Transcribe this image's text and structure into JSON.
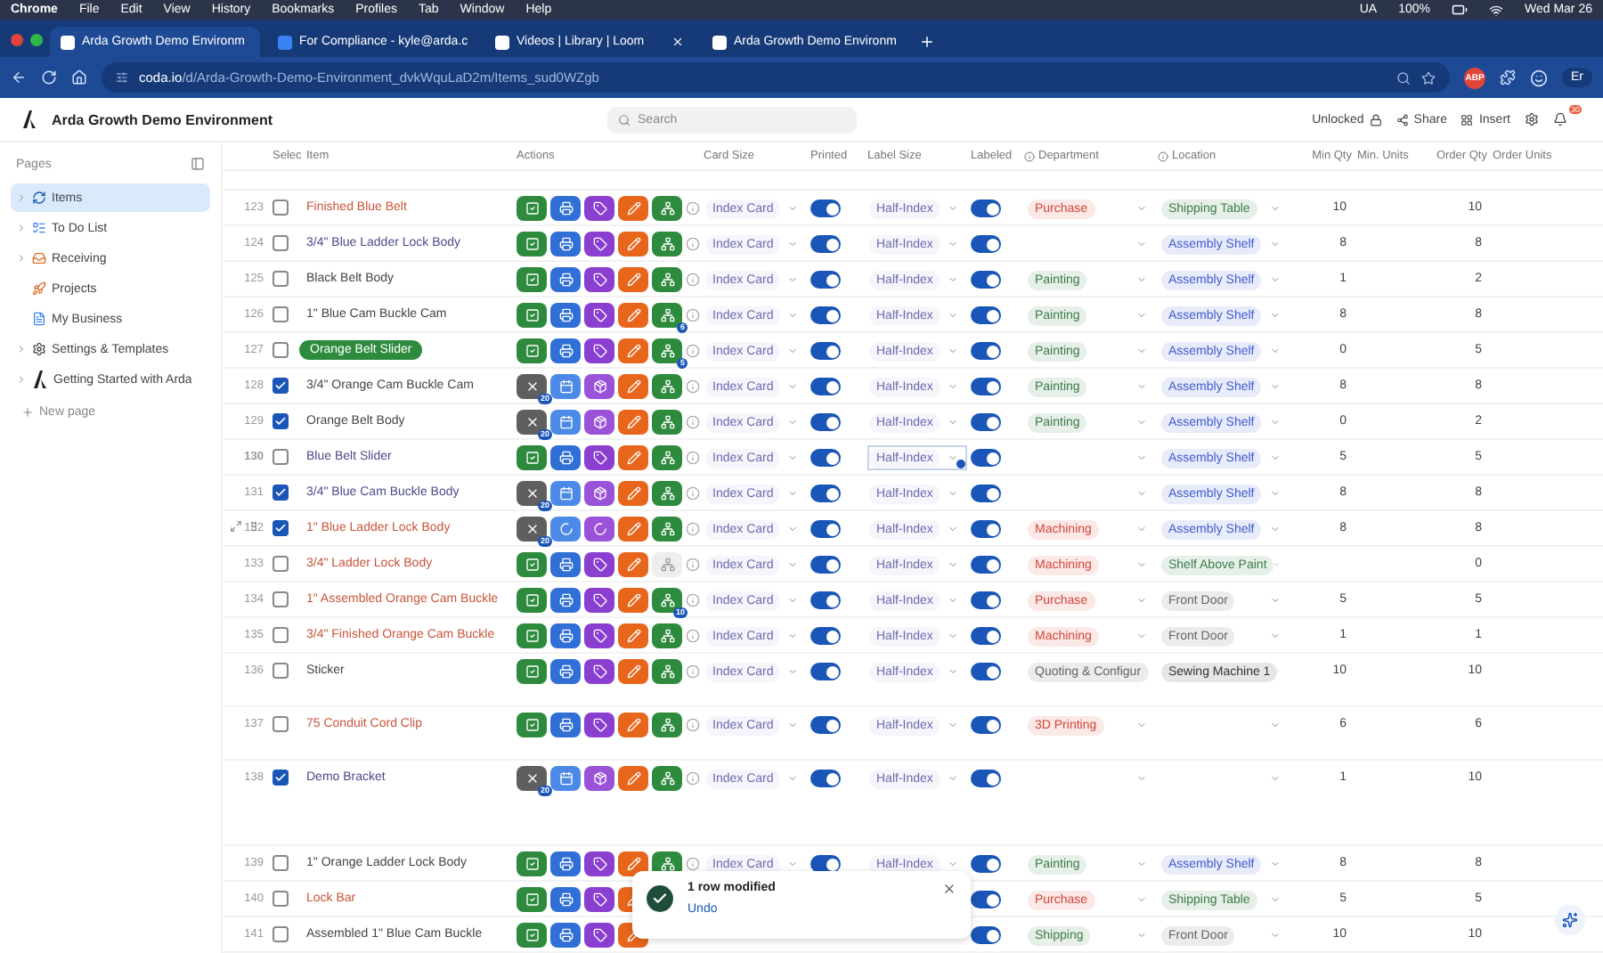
{
  "menu_bar": {
    "app": "Chrome",
    "menus": [
      "File",
      "Edit",
      "View",
      "History",
      "Bookmarks",
      "Profiles",
      "Tab",
      "Window",
      "Help"
    ],
    "keyboard": "UA",
    "battery": "100%",
    "clock": "Wed Mar 26"
  },
  "browser": {
    "tabs": [
      {
        "title": "Arda Growth Demo Environm",
        "selected": true
      },
      {
        "title": "For Compliance - kyle@arda.c",
        "selected": false
      },
      {
        "title": "Videos | Library | Loom",
        "selected": false
      },
      {
        "title": "Arda Growth Demo Environm",
        "selected": false
      }
    ],
    "url_host": "coda.io",
    "url_path": "/d/Arda-Growth-Demo-Environment_dvkWquLaD2m/Items_sud0WZgb",
    "extension_badge": "ABP",
    "profile": "Er"
  },
  "doc": {
    "title": "Arda Growth Demo Environment",
    "search_placeholder": "Search",
    "lock_status": "Unlocked",
    "share": "Share",
    "insert": "Insert",
    "notification_count": "30"
  },
  "sidebar": {
    "heading": "Pages",
    "items": [
      {
        "label": "Items",
        "selected": true,
        "expandable": true
      },
      {
        "label": "To Do List",
        "selected": false,
        "expandable": true
      },
      {
        "label": "Receiving",
        "selected": false,
        "expandable": true
      },
      {
        "label": "Projects",
        "selected": false,
        "expandable": false
      },
      {
        "label": "My Business",
        "selected": false,
        "expandable": false
      },
      {
        "label": "Settings & Templates",
        "selected": false,
        "expandable": true
      },
      {
        "label": "Getting Started with Arda",
        "selected": false,
        "expandable": true
      }
    ],
    "new_page": "New page"
  },
  "table": {
    "columns": [
      {
        "label": "Selec",
        "info": false
      },
      {
        "label": "Item",
        "info": false
      },
      {
        "label": "Actions",
        "info": false
      },
      {
        "label": "Card Size",
        "info": false
      },
      {
        "label": "Printed",
        "info": false
      },
      {
        "label": "Label Size",
        "info": false
      },
      {
        "label": "Labeled",
        "info": false
      },
      {
        "label": "Department",
        "info": true
      },
      {
        "label": "Location",
        "info": true
      },
      {
        "label": "Min Qty",
        "info": false
      },
      {
        "label": "Min. Units",
        "info": false
      },
      {
        "label": "Order Qty",
        "info": false
      },
      {
        "label": "Order Units",
        "info": false
      }
    ],
    "rows": [
      {
        "number": "123",
        "checked": false,
        "item": {
          "text": "Finished Blue Belt",
          "kind": "text",
          "color": "#c9553b"
        },
        "actions": {
          "kind": "ready",
          "share_disabled": false
        },
        "card_size": "Index Card",
        "printed": true,
        "label_size": "Half-Index",
        "label_focused": false,
        "labeled": true,
        "department": {
          "text": "Purchase",
          "color": "#d4473a"
        },
        "location": {
          "text": "Shipping Table",
          "color": "#3b7d48"
        },
        "min_qty": "10",
        "order_qty": "10",
        "hovered": false
      },
      {
        "number": "124",
        "checked": false,
        "item": {
          "text": "3/4\" Blue Ladder Lock Body",
          "kind": "text",
          "color": "#4b4a8c"
        },
        "actions": {
          "kind": "ready",
          "share_disabled": false
        },
        "card_size": "Index Card",
        "printed": true,
        "label_size": "Half-Index",
        "label_focused": false,
        "labeled": true,
        "location": {
          "text": "Assembly Shelf",
          "color": "#3f5bd0"
        },
        "min_qty": "8",
        "order_qty": "8",
        "hovered": false
      },
      {
        "number": "125",
        "checked": false,
        "item": {
          "text": "Black Belt Body",
          "kind": "text",
          "color": "#444444"
        },
        "actions": {
          "kind": "ready",
          "share_disabled": false
        },
        "card_size": "Index Card",
        "printed": true,
        "label_size": "Half-Index",
        "label_focused": false,
        "labeled": true,
        "department": {
          "text": "Painting",
          "color": "#3b7d48"
        },
        "location": {
          "text": "Assembly Shelf",
          "color": "#3f5bd0"
        },
        "min_qty": "1",
        "order_qty": "2",
        "hovered": false
      },
      {
        "number": "126",
        "checked": false,
        "item": {
          "text": "1\" Blue Cam Buckle Cam",
          "kind": "text",
          "color": "#444444"
        },
        "actions": {
          "kind": "ready",
          "share_disabled": false,
          "badge": "6"
        },
        "card_size": "Index Card",
        "printed": true,
        "label_size": "Half-Index",
        "label_focused": false,
        "labeled": true,
        "department": {
          "text": "Painting",
          "color": "#3b7d48"
        },
        "location": {
          "text": "Assembly Shelf",
          "color": "#3f5bd0"
        },
        "min_qty": "8",
        "order_qty": "8",
        "hovered": false
      },
      {
        "number": "127",
        "checked": false,
        "item": {
          "text": "Orange Belt Slider",
          "kind": "pill",
          "color": "#2e8b3e"
        },
        "actions": {
          "kind": "ready",
          "share_disabled": false,
          "badge": "5"
        },
        "card_size": "Index Card",
        "printed": true,
        "label_size": "Half-Index",
        "label_focused": false,
        "labeled": true,
        "department": {
          "text": "Painting",
          "color": "#3b7d48"
        },
        "location": {
          "text": "Assembly Shelf",
          "color": "#3f5bd0"
        },
        "min_qty": "0",
        "order_qty": "5",
        "hovered": false
      },
      {
        "number": "128",
        "checked": true,
        "item": {
          "text": "3/4\" Orange Cam Buckle Cam",
          "kind": "text",
          "color": "#444444"
        },
        "actions": {
          "kind": "printed",
          "count": "20",
          "share_disabled": false
        },
        "card_size": "Index Card",
        "printed": true,
        "label_size": "Half-Index",
        "label_focused": false,
        "labeled": true,
        "department": {
          "text": "Painting",
          "color": "#3b7d48"
        },
        "location": {
          "text": "Assembly Shelf",
          "color": "#3f5bd0"
        },
        "min_qty": "8",
        "order_qty": "8",
        "hovered": false
      },
      {
        "number": "129",
        "checked": true,
        "item": {
          "text": "Orange Belt Body",
          "kind": "text",
          "color": "#444444"
        },
        "actions": {
          "kind": "printed",
          "count": "20",
          "share_disabled": false
        },
        "card_size": "Index Card",
        "printed": true,
        "label_size": "Half-Index",
        "label_focused": false,
        "labeled": true,
        "department": {
          "text": "Painting",
          "color": "#3b7d48"
        },
        "location": {
          "text": "Assembly Shelf",
          "color": "#3f5bd0"
        },
        "min_qty": "0",
        "order_qty": "2",
        "hovered": false
      },
      {
        "number": "130",
        "checked": false,
        "item": {
          "text": "Blue Belt Slider",
          "kind": "text",
          "color": "#4b4a8c"
        },
        "actions": {
          "kind": "ready",
          "share_disabled": false
        },
        "card_size": "Index Card",
        "printed": true,
        "label_size": "Half-Index",
        "label_focused": true,
        "labeled": true,
        "location": {
          "text": "Assembly Shelf",
          "color": "#3f5bd0"
        },
        "min_qty": "5",
        "order_qty": "5",
        "hovered": false
      },
      {
        "number": "131",
        "checked": true,
        "item": {
          "text": "3/4\" Blue Cam Buckle Body",
          "kind": "text",
          "color": "#4b4a8c"
        },
        "actions": {
          "kind": "printed",
          "count": "20",
          "share_disabled": false
        },
        "card_size": "Index Card",
        "printed": true,
        "label_size": "Half-Index",
        "label_focused": false,
        "labeled": true,
        "location": {
          "text": "Assembly Shelf",
          "color": "#3f5bd0"
        },
        "min_qty": "8",
        "order_qty": "8",
        "hovered": false
      },
      {
        "number": "132",
        "checked": true,
        "item": {
          "text": "1\" Blue Ladder Lock Body",
          "kind": "text",
          "color": "#c9553b"
        },
        "actions": {
          "kind": "loading",
          "count": "20",
          "share_disabled": false
        },
        "card_size": "Index Card",
        "printed": true,
        "label_size": "Half-Index",
        "label_focused": false,
        "labeled": true,
        "department": {
          "text": "Machining",
          "color": "#d4473a"
        },
        "location": {
          "text": "Assembly Shelf",
          "color": "#3f5bd0"
        },
        "min_qty": "8",
        "order_qty": "8",
        "hovered": true
      },
      {
        "number": "133",
        "checked": false,
        "item": {
          "text": "3/4\" Ladder Lock Body",
          "kind": "text",
          "color": "#c9553b"
        },
        "actions": {
          "kind": "ready",
          "share_disabled": true
        },
        "card_size": "Index Card",
        "printed": true,
        "label_size": "Half-Index",
        "label_focused": false,
        "labeled": true,
        "department": {
          "text": "Machining",
          "color": "#d4473a"
        },
        "location": {
          "text": "Shelf Above Paint",
          "color": "#3b7d48"
        },
        "order_qty": "0",
        "hovered": false
      },
      {
        "number": "134",
        "checked": false,
        "item": {
          "text": "1\" Assembled Orange Cam Buckle",
          "kind": "text",
          "color": "#c9553b"
        },
        "actions": {
          "kind": "ready",
          "share_disabled": false,
          "badge": "10"
        },
        "card_size": "Index Card",
        "printed": true,
        "label_size": "Half-Index",
        "label_focused": false,
        "labeled": true,
        "department": {
          "text": "Purchase",
          "color": "#d4473a"
        },
        "location": {
          "text": "Front Door",
          "color": "#666666"
        },
        "min_qty": "5",
        "order_qty": "5",
        "hovered": false
      },
      {
        "number": "135",
        "checked": false,
        "item": {
          "text": "3/4\" Finished Orange Cam Buckle",
          "kind": "text",
          "color": "#c9553b"
        },
        "actions": {
          "kind": "ready",
          "share_disabled": false
        },
        "card_size": "Index Card",
        "printed": true,
        "label_size": "Half-Index",
        "label_focused": false,
        "labeled": true,
        "department": {
          "text": "Machining",
          "color": "#d4473a"
        },
        "location": {
          "text": "Front Door",
          "color": "#666666"
        },
        "min_qty": "1",
        "order_qty": "1",
        "hovered": false
      },
      {
        "number": "136",
        "checked": false,
        "item": {
          "text": "Sticker",
          "kind": "text",
          "color": "#444444"
        },
        "actions": {
          "kind": "ready",
          "share_disabled": false
        },
        "card_size": "Index Card",
        "printed": true,
        "label_size": "Half-Index",
        "label_focused": false,
        "labeled": true,
        "department": {
          "text": "Quoting & Configur",
          "color": "#666666"
        },
        "location": {
          "text": "Sewing Machine 1",
          "color": "#333333"
        },
        "min_qty": "10",
        "order_qty": "10",
        "hovered": false
      },
      {
        "number": "137",
        "checked": false,
        "item": {
          "text": "75 Conduit Cord Clip",
          "kind": "text",
          "color": "#c9553b"
        },
        "actions": {
          "kind": "ready",
          "share_disabled": false
        },
        "card_size": "Index Card",
        "printed": true,
        "label_size": "Half-Index",
        "label_focused": false,
        "labeled": true,
        "department": {
          "text": "3D Printing",
          "color": "#d4473a"
        },
        "min_qty": "6",
        "order_qty": "6",
        "hovered": false
      },
      {
        "number": "138",
        "checked": true,
        "item": {
          "text": "Demo Bracket",
          "kind": "text",
          "color": "#4b4a8c"
        },
        "actions": {
          "kind": "printed",
          "count": "20",
          "share_disabled": false
        },
        "card_size": "Index Card",
        "printed": true,
        "label_size": "Half-Index",
        "label_focused": false,
        "labeled": true,
        "min_qty": "1",
        "order_qty": "10",
        "hovered": false
      },
      {
        "number": "139",
        "checked": false,
        "item": {
          "text": "1\" Orange Ladder Lock Body",
          "kind": "text",
          "color": "#444444"
        },
        "actions": {
          "kind": "ready",
          "share_disabled": false
        },
        "card_size": "Index Card",
        "printed": true,
        "label_size": "Half-Index",
        "label_focused": false,
        "labeled": true,
        "department": {
          "text": "Painting",
          "color": "#3b7d48"
        },
        "location": {
          "text": "Assembly Shelf",
          "color": "#3f5bd0"
        },
        "min_qty": "8",
        "order_qty": "8",
        "hovered": false
      },
      {
        "number": "140",
        "checked": false,
        "item": {
          "text": "Lock Bar",
          "kind": "text",
          "color": "#c9553b"
        },
        "actions": {
          "kind": "ready"
        },
        "labeled": true,
        "department": {
          "text": "Purchase",
          "color": "#d4473a"
        },
        "location": {
          "text": "Shipping Table",
          "color": "#3b7d48"
        },
        "min_qty": "5",
        "order_qty": "5",
        "hovered": false
      },
      {
        "number": "141",
        "checked": false,
        "item": {
          "text": "Assembled 1\" Blue Cam Buckle",
          "kind": "text",
          "color": "#444444"
        },
        "actions": {
          "kind": "ready"
        },
        "labeled": true,
        "department": {
          "text": "Shipping",
          "color": "#3b7d48"
        },
        "location": {
          "text": "Front Door",
          "color": "#666666"
        },
        "min_qty": "10",
        "order_qty": "10",
        "hovered": false
      }
    ]
  },
  "toast": {
    "message": "1 row modified",
    "action": "Undo"
  }
}
